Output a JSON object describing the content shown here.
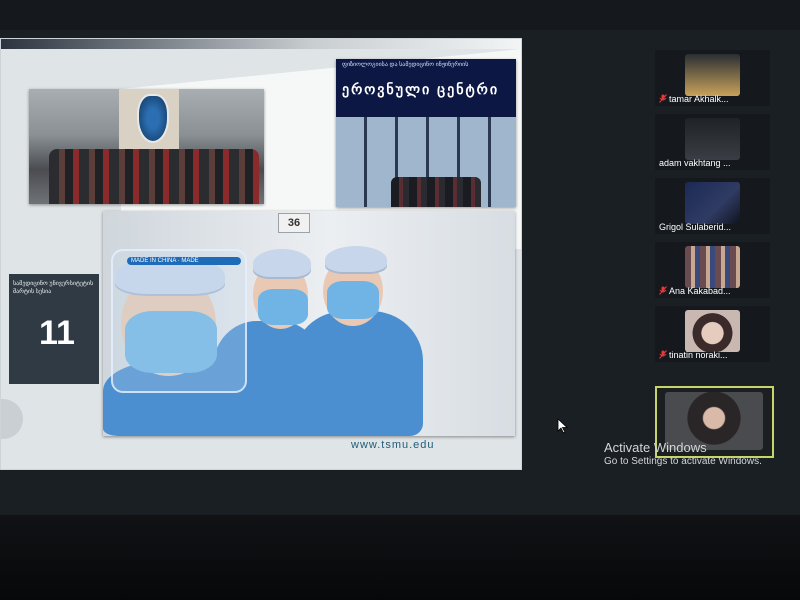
{
  "slide": {
    "emblem_label": "",
    "center_banner_small": "ფიზიოლოგიისა და სამედიცინო ინჟინერიის",
    "center_banner_big": "ეროვნული ცენტრი",
    "sign_number": "36",
    "shield_band_text": "MADE IN CHINA · MADE",
    "left_box_text": "სამედიცინო უნივერსიტეტის მარტის სესია",
    "left_box_number": "11",
    "url": "www.tsmu.edu"
  },
  "participants": [
    {
      "name": "tamar Akhalk...",
      "muted": true,
      "tint": "#c8a25a"
    },
    {
      "name": "adam vakhtang ...",
      "muted": false,
      "tint": "#2a2e33"
    },
    {
      "name": "Grigol Sulaberid...",
      "muted": false,
      "tint": "#1f2a48"
    },
    {
      "name": "Ana Kakabad...",
      "muted": true,
      "tint": "#6a4b4f"
    },
    {
      "name": "tinatin noraki...",
      "muted": true,
      "tint": "#c9b7b2"
    }
  ],
  "active_participant": {
    "name": "",
    "tint": "#4a4b4f"
  },
  "activation": {
    "title": "Activate Windows",
    "subtitle": "Go to Settings to activate Windows."
  },
  "colors": {
    "accent_active": "#c6d46a",
    "muted_red": "#e23b3b"
  }
}
